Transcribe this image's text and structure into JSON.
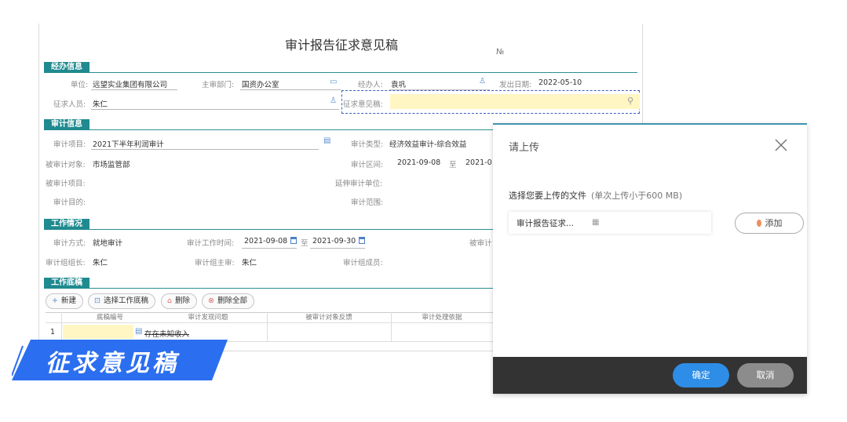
{
  "form": {
    "title": "审计报告征求意见稿",
    "serial_label": "№",
    "sections": {
      "handling": "经办信息",
      "audit": "审计信息",
      "work": "工作情况",
      "draft": "工作底稿"
    },
    "handling": {
      "unit_label": "单位:",
      "unit_value": "远望实业集团有限公司",
      "dept_label": "主审部门:",
      "dept_value": "国资办公室",
      "handler_label": "经办人:",
      "handler_value": "袁巩",
      "date_label": "发出日期:",
      "date_value": "2022-05-10",
      "person_label": "征求人员:",
      "person_value": "朱仁",
      "opinion_label": "征求意见稿:"
    },
    "audit": {
      "project_label": "审计项目:",
      "project_value": "2021下半年利润审计",
      "type_label": "审计类型:",
      "type_value": "经济效益审计-综合效益",
      "object_label": "被审计对象:",
      "object_value": "市场监管部",
      "interval_label": "审计区间:",
      "interval_start": "2021-09-08",
      "interval_sep": "至",
      "interval_end": "2021-0",
      "audited_project_label": "被审计项目:",
      "extend_unit_label": "延伸审计单位:",
      "purpose_label": "审计目的:",
      "scope_label": "审计范围:"
    },
    "work": {
      "method_label": "审计方式:",
      "method_value": "就地审计",
      "time_label": "审计工作时间:",
      "time_start": "2021-09-08",
      "time_sep": "至",
      "time_end": "2021-09-30",
      "audited_label": "被审计",
      "leader_label": "审计组组长:",
      "leader_value": "朱仁",
      "chief_label": "审计组主审:",
      "chief_value": "朱仁",
      "members_label": "审计组成员:"
    },
    "draft": {
      "new_btn": "新建",
      "select_btn": "选择工作底稿",
      "delete_btn": "删除",
      "delete_all_btn": "删除全部",
      "columns": [
        "底稿编号",
        "审计发现问题",
        "被审计对象反馈",
        "审计处理依据"
      ],
      "rows": [
        {
          "index": "1",
          "problem": "存在未知收入"
        }
      ]
    }
  },
  "banner": {
    "text": "征求意见稿",
    "color": "#2b6ef0"
  },
  "dialog": {
    "title": "请上传",
    "choose_label": "选择您要上传的文件",
    "choose_hint": "(单次上传小于600 MB)",
    "file_name": "审计报告征求...",
    "add_button": "添加",
    "ok_button": "确定",
    "cancel_button": "取消"
  },
  "colors": {
    "section_tag": "#1f8a8f",
    "highlight": "#fff6c4",
    "primary_button": "#2e8de6",
    "footer": "#333333"
  }
}
